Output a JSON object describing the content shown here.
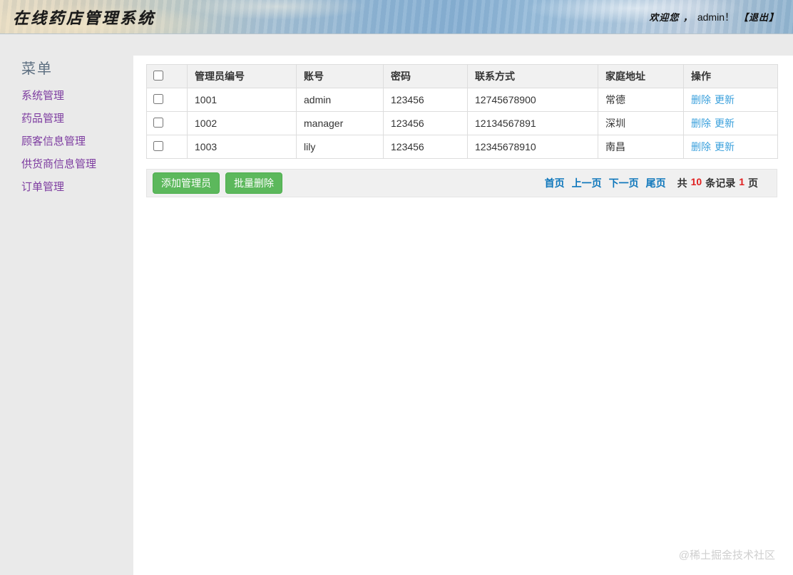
{
  "header": {
    "title": "在线药店管理系统",
    "welcome_prefix": "欢迎您 ，",
    "username": "admin！",
    "logout_label": "【退出】"
  },
  "sidebar": {
    "heading": "菜单",
    "items": [
      {
        "label": "系统管理"
      },
      {
        "label": "药品管理"
      },
      {
        "label": "顾客信息管理"
      },
      {
        "label": "供货商信息管理"
      },
      {
        "label": "订单管理"
      }
    ]
  },
  "table": {
    "columns": [
      "管理员编号",
      "账号",
      "密码",
      "联系方式",
      "家庭地址",
      "操作"
    ],
    "rows": [
      {
        "id": "1001",
        "account": "admin",
        "password": "123456",
        "contact": "12745678900",
        "address": "常德",
        "delete_label": "删除",
        "update_label": "更新"
      },
      {
        "id": "1002",
        "account": "manager",
        "password": "123456",
        "contact": "12134567891",
        "address": "深圳",
        "delete_label": "删除",
        "update_label": "更新"
      },
      {
        "id": "1003",
        "account": "lily",
        "password": "123456",
        "contact": "12345678910",
        "address": "南昌",
        "delete_label": "删除",
        "update_label": "更新"
      }
    ]
  },
  "toolbar": {
    "add_admin_label": "添加管理员",
    "batch_delete_label": "批量删除"
  },
  "pagination": {
    "first": "首页",
    "prev": "上一页",
    "next": "下一页",
    "last": "尾页",
    "total_prefix": "共",
    "total_count": "10",
    "total_suffix": "条记录",
    "page_count": "1",
    "page_suffix": "页"
  },
  "watermark": "@稀土掘金技术社区",
  "colors": {
    "button_green": "#5cb85c",
    "button_green_border": "#4cae4c",
    "action_link_blue": "#3aa0dc",
    "pager_link_blue": "#0d76bb",
    "count_red": "#e02020",
    "menu_link_purple": "#7d3ca0",
    "sidebar_bg": "#eaeaea",
    "table_header_bg": "#f1f1f1"
  }
}
